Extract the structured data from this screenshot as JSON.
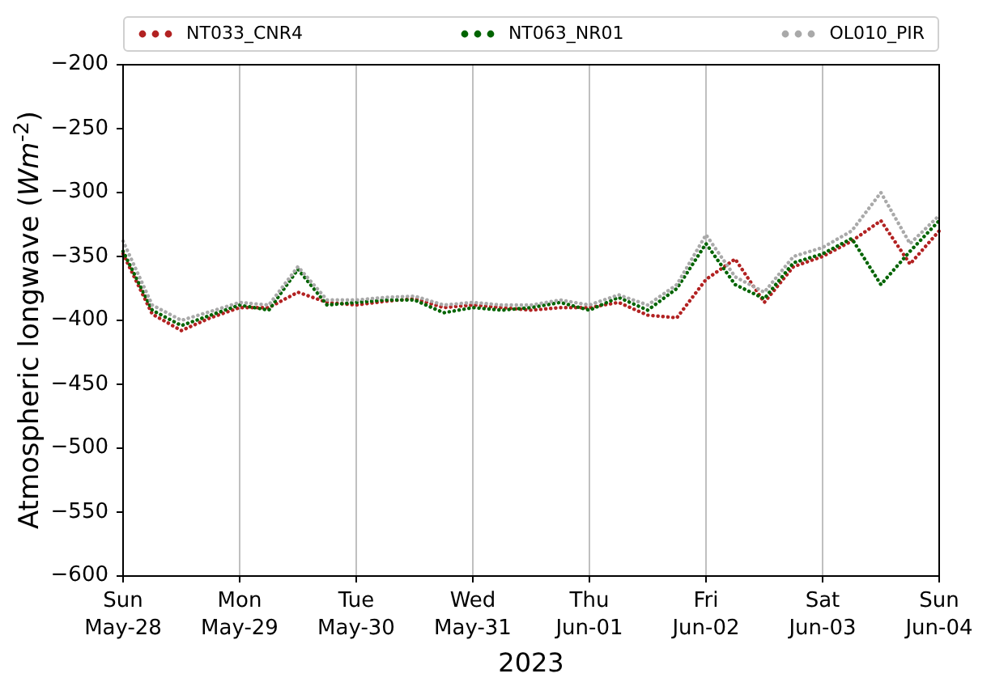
{
  "chart_data": {
    "type": "line",
    "grid": true,
    "legend": true,
    "xlabel": "2023",
    "ylabel": "Atmospheric longwave (*Wm*$^{-2}$)",
    "categories": [
      "Sun\nMay-28",
      null,
      null,
      null,
      "Mon\nMay-29",
      null,
      null,
      null,
      "Tue\nMay-30",
      null,
      null,
      null,
      "Wed\nMay-31",
      null,
      null,
      null,
      "Thu\nJun-01",
      null,
      null,
      null,
      "Fri\nJun-02",
      null,
      null,
      null,
      "Sat\nJun-03",
      null,
      null,
      null,
      "Sun\nJun-04"
    ],
    "series": [
      {
        "name": "NT033_CNR4",
        "color": "#b22222",
        "line_style": "dotted",
        "values": [
          -348,
          -395,
          -408,
          -398,
          -390,
          -390,
          -378,
          -386,
          -388,
          -385,
          -383,
          -390,
          -388,
          -390,
          -392,
          -390,
          -390,
          -386,
          -396,
          -398,
          -368,
          -352,
          -386,
          -358,
          -350,
          -338,
          -322,
          -356,
          -330
        ]
      },
      {
        "name": "NT063_NR01",
        "color": "#006400",
        "line_style": "dotted",
        "values": [
          -346,
          -392,
          -404,
          -396,
          -388,
          -392,
          -360,
          -388,
          -386,
          -384,
          -384,
          -394,
          -390,
          -392,
          -390,
          -386,
          -392,
          -382,
          -392,
          -375,
          -340,
          -372,
          -383,
          -355,
          -348,
          -336,
          -372,
          -346,
          -322
        ]
      },
      {
        "name": "OL010_PIR",
        "color": "#a9a9a9",
        "line_style": "dotted",
        "values": [
          -338,
          -388,
          -400,
          -393,
          -386,
          -388,
          -358,
          -384,
          -384,
          -382,
          -381,
          -388,
          -386,
          -388,
          -388,
          -384,
          -388,
          -380,
          -388,
          -372,
          -333,
          -366,
          -378,
          -350,
          -343,
          -330,
          -300,
          -340,
          -318
        ]
      }
    ],
    "ylim": [
      -600,
      -200
    ],
    "yticks": [
      {
        "value": -600,
        "label": "−600"
      },
      {
        "value": -550,
        "label": "−550"
      },
      {
        "value": -500,
        "label": "−500"
      },
      {
        "value": -450,
        "label": "−450"
      },
      {
        "value": -400,
        "label": "−400"
      },
      {
        "value": -350,
        "label": "−350"
      },
      {
        "value": -300,
        "label": "−300"
      },
      {
        "value": -250,
        "label": "−250"
      },
      {
        "value": -200,
        "label": "−200"
      }
    ]
  }
}
